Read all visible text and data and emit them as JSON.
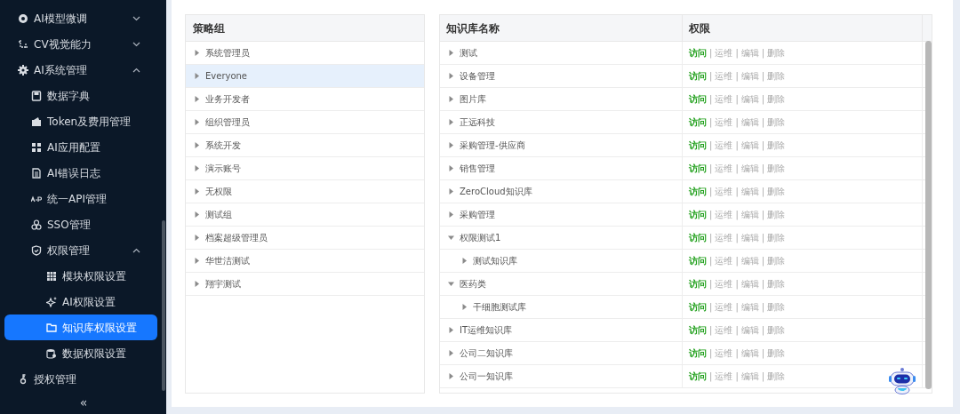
{
  "sidebar": {
    "items": [
      {
        "label": "AI模型微调",
        "expanded": false,
        "selected": false
      },
      {
        "label": "CV视觉能力",
        "expanded": false,
        "selected": false
      },
      {
        "label": "AI系统管理",
        "expanded": true,
        "selected": false,
        "children": [
          {
            "label": "数据字典",
            "selected": false
          },
          {
            "label": "Token及费用管理",
            "selected": false
          },
          {
            "label": "AI应用配置",
            "selected": false
          },
          {
            "label": "AI错误日志",
            "selected": false
          },
          {
            "label": "统一API管理",
            "selected": false
          },
          {
            "label": "SSO管理",
            "selected": false
          },
          {
            "label": "权限管理",
            "expanded": true,
            "selected": false,
            "children": [
              {
                "label": "模块权限设置",
                "selected": false
              },
              {
                "label": "AI权限设置",
                "selected": false
              },
              {
                "label": "知识库权限设置",
                "selected": true
              },
              {
                "label": "数据权限设置",
                "selected": false
              }
            ]
          }
        ]
      },
      {
        "label": "授权管理",
        "selected": false
      }
    ],
    "collapse_button": "«"
  },
  "policy_groups": {
    "heading": "策略组",
    "items": [
      {
        "label": "系统管理员",
        "expanded": false,
        "selected": false
      },
      {
        "label": "Everyone",
        "expanded": false,
        "selected": true
      },
      {
        "label": "业务开发者",
        "expanded": false,
        "selected": false
      },
      {
        "label": "组织管理员",
        "expanded": false,
        "selected": false
      },
      {
        "label": "系统开发",
        "expanded": false,
        "selected": false
      },
      {
        "label": "演示账号",
        "expanded": false,
        "selected": false
      },
      {
        "label": "无权限",
        "expanded": false,
        "selected": false
      },
      {
        "label": "测试组",
        "expanded": false,
        "selected": false
      },
      {
        "label": "档案超级管理员",
        "expanded": false,
        "selected": false
      },
      {
        "label": "华世洁测试",
        "expanded": false,
        "selected": false
      },
      {
        "label": "翔宇测试",
        "expanded": false,
        "selected": false
      }
    ]
  },
  "knowledge_table": {
    "columns": [
      "知识库名称",
      "权限"
    ],
    "separator": "|",
    "rows": [
      {
        "name": "测试",
        "expanded": false,
        "permissions": [
          {
            "label": "访问",
            "granted": true
          },
          {
            "label": "运维",
            "granted": false
          },
          {
            "label": "编辑",
            "granted": false
          },
          {
            "label": "删除",
            "granted": false
          }
        ]
      },
      {
        "name": "设备管理",
        "expanded": false,
        "permissions": [
          {
            "label": "访问",
            "granted": true
          },
          {
            "label": "运维",
            "granted": false
          },
          {
            "label": "编辑",
            "granted": false
          },
          {
            "label": "删除",
            "granted": false
          }
        ]
      },
      {
        "name": "图片库",
        "expanded": false,
        "permissions": [
          {
            "label": "访问",
            "granted": true
          },
          {
            "label": "运维",
            "granted": false
          },
          {
            "label": "编辑",
            "granted": false
          },
          {
            "label": "删除",
            "granted": false
          }
        ]
      },
      {
        "name": "正远科技",
        "expanded": false,
        "permissions": [
          {
            "label": "访问",
            "granted": true
          },
          {
            "label": "运维",
            "granted": false
          },
          {
            "label": "编辑",
            "granted": false
          },
          {
            "label": "删除",
            "granted": false
          }
        ]
      },
      {
        "name": "采购管理-供应商",
        "expanded": false,
        "permissions": [
          {
            "label": "访问",
            "granted": true
          },
          {
            "label": "运维",
            "granted": false
          },
          {
            "label": "编辑",
            "granted": false
          },
          {
            "label": "删除",
            "granted": false
          }
        ]
      },
      {
        "name": "销售管理",
        "expanded": false,
        "permissions": [
          {
            "label": "访问",
            "granted": true
          },
          {
            "label": "运维",
            "granted": false
          },
          {
            "label": "编辑",
            "granted": false
          },
          {
            "label": "删除",
            "granted": false
          }
        ]
      },
      {
        "name": "ZeroCloud知识库",
        "expanded": false,
        "permissions": [
          {
            "label": "访问",
            "granted": true
          },
          {
            "label": "运维",
            "granted": false
          },
          {
            "label": "编辑",
            "granted": false
          },
          {
            "label": "删除",
            "granted": false
          }
        ]
      },
      {
        "name": "采购管理",
        "expanded": false,
        "permissions": [
          {
            "label": "访问",
            "granted": true
          },
          {
            "label": "运维",
            "granted": false
          },
          {
            "label": "编辑",
            "granted": false
          },
          {
            "label": "删除",
            "granted": false
          }
        ]
      },
      {
        "name": "权限测试1",
        "expanded": true,
        "permissions": [
          {
            "label": "访问",
            "granted": true
          },
          {
            "label": "运维",
            "granted": false
          },
          {
            "label": "编辑",
            "granted": false
          },
          {
            "label": "删除",
            "granted": false
          }
        ],
        "children": [
          {
            "name": "测试知识库",
            "expanded": false,
            "permissions": [
              {
                "label": "访问",
                "granted": true
              },
              {
                "label": "运维",
                "granted": false
              },
              {
                "label": "编辑",
                "granted": false
              },
              {
                "label": "删除",
                "granted": false
              }
            ]
          }
        ]
      },
      {
        "name": "医药类",
        "expanded": true,
        "permissions": [
          {
            "label": "访问",
            "granted": true
          },
          {
            "label": "运维",
            "granted": false
          },
          {
            "label": "编辑",
            "granted": false
          },
          {
            "label": "删除",
            "granted": false
          }
        ],
        "children": [
          {
            "name": "干细胞测试库",
            "expanded": false,
            "permissions": [
              {
                "label": "访问",
                "granted": true
              },
              {
                "label": "运维",
                "granted": false
              },
              {
                "label": "编辑",
                "granted": false
              },
              {
                "label": "删除",
                "granted": false
              }
            ]
          }
        ]
      },
      {
        "name": "IT运维知识库",
        "expanded": false,
        "permissions": [
          {
            "label": "访问",
            "granted": true
          },
          {
            "label": "运维",
            "granted": false
          },
          {
            "label": "编辑",
            "granted": false
          },
          {
            "label": "删除",
            "granted": false
          }
        ]
      },
      {
        "name": "公司二知识库",
        "expanded": false,
        "permissions": [
          {
            "label": "访问",
            "granted": true
          },
          {
            "label": "运维",
            "granted": false
          },
          {
            "label": "编辑",
            "granted": false
          },
          {
            "label": "删除",
            "granted": false
          }
        ]
      },
      {
        "name": "公司一知识库",
        "expanded": false,
        "permissions": [
          {
            "label": "访问",
            "granted": true
          },
          {
            "label": "运维",
            "granted": false
          },
          {
            "label": "编辑",
            "granted": false
          },
          {
            "label": "删除",
            "granted": false
          }
        ]
      }
    ]
  }
}
